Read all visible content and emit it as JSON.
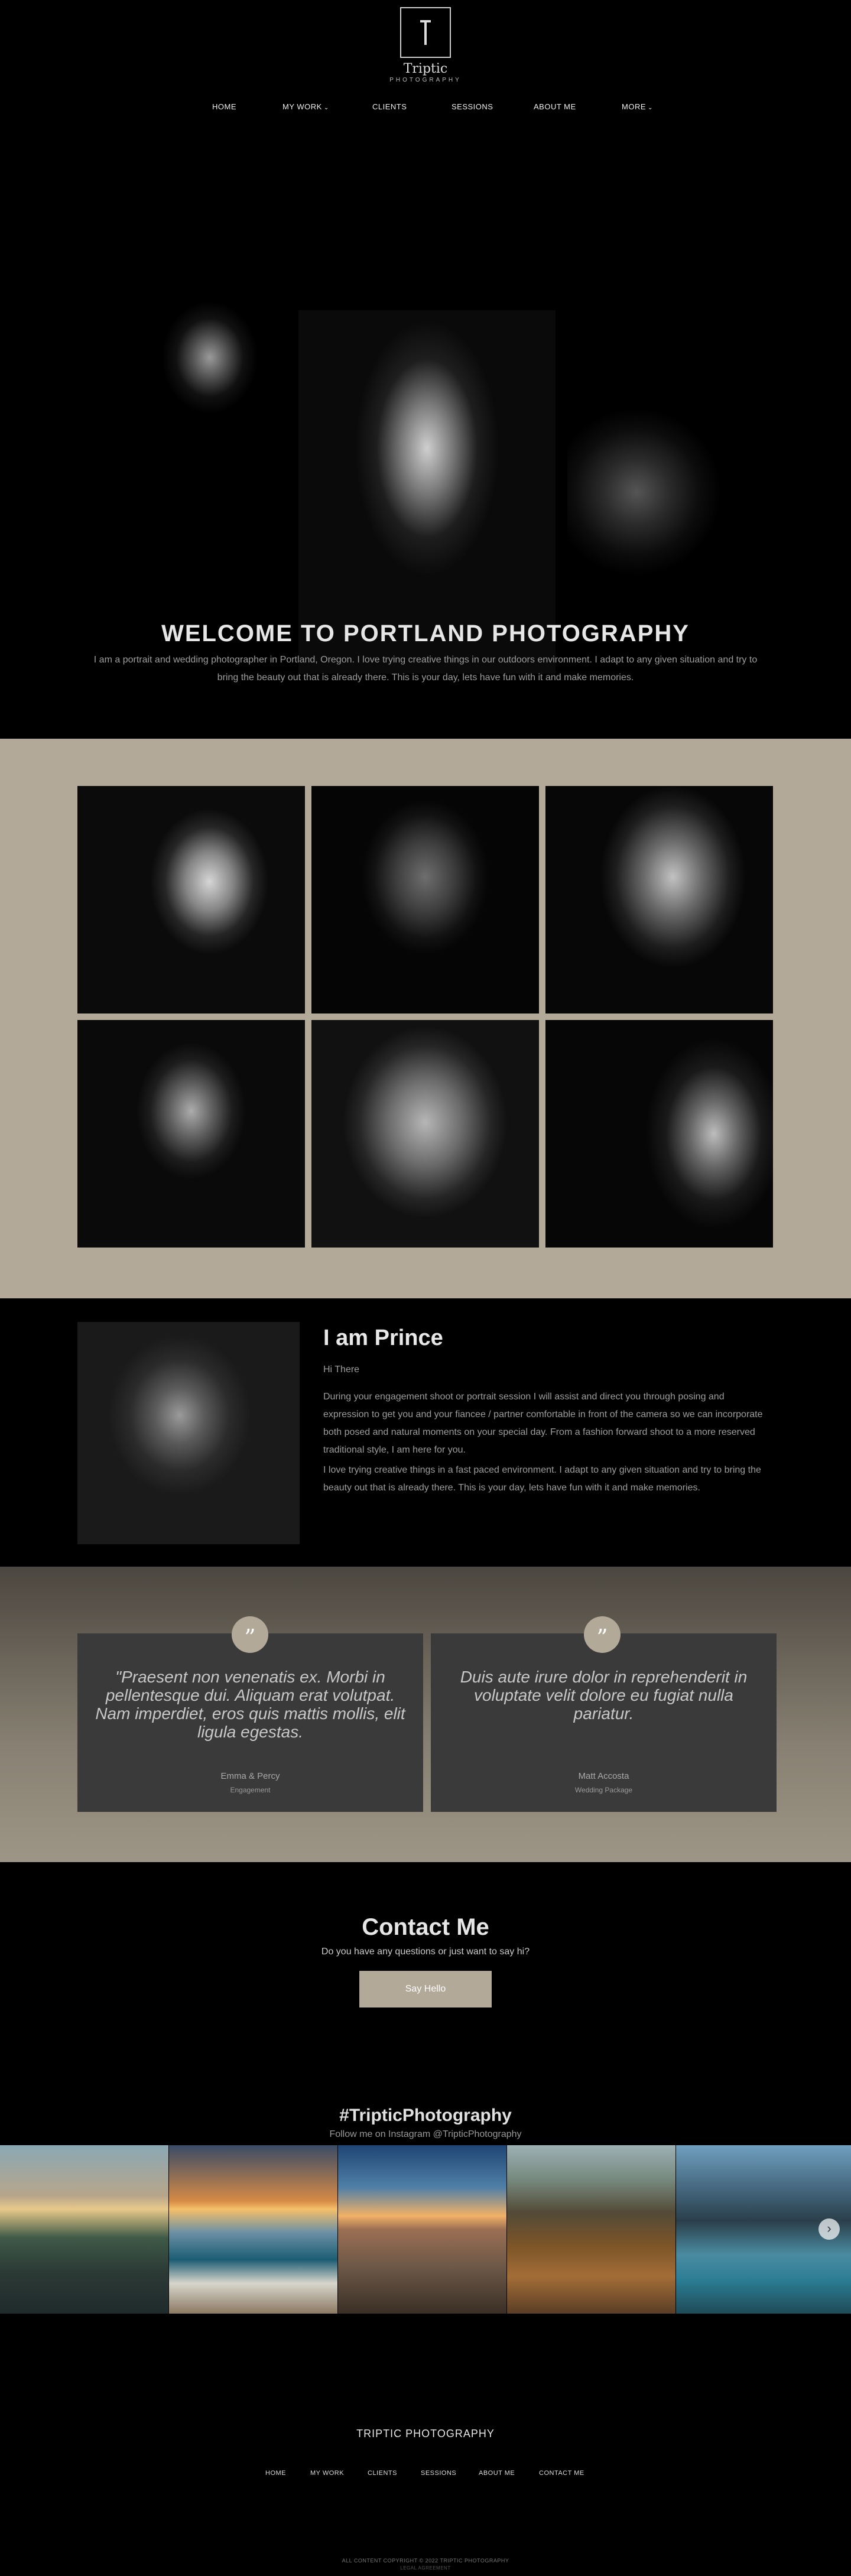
{
  "brand": {
    "name": "Triptic",
    "tagline": "PHOTOGRAPHY"
  },
  "nav": {
    "items": [
      {
        "label": "HOME",
        "dropdown": false
      },
      {
        "label": "MY WORK",
        "dropdown": true
      },
      {
        "label": "CLIENTS",
        "dropdown": false
      },
      {
        "label": "SESSIONS",
        "dropdown": false
      },
      {
        "label": "ABOUT ME",
        "dropdown": false
      },
      {
        "label": "MORE",
        "dropdown": true
      }
    ],
    "dropdown_icon": "chevron-down-icon"
  },
  "hero": {
    "title": "WELCOME TO PORTLAND PHOTOGRAPHY",
    "text": "I am a portrait and wedding photographer in Portland, Oregon. I love trying creative things in our outdoors environment. I adapt to any given situation and try to bring the beauty out that is already there. This is your day, lets have fun with it and make memories."
  },
  "gallery": {
    "background": "#b2a999",
    "tile_count": 6
  },
  "about": {
    "title": "I am Prince",
    "greeting": "Hi There",
    "paragraph1": "During your engagement shoot or portrait session I will assist and direct you through posing and expression to get you and your fiancee / partner comfortable in front of the camera so we can incorporate both posed and natural moments on your special day. From a fashion forward shoot to a more reserved traditional style, I am here for you.",
    "paragraph2": "I love trying creative things in a fast paced environment. I adapt to any given situation and try to bring the beauty out that is already there. This is your day, lets have fun with it and make memories."
  },
  "testimonials": [
    {
      "quote": "\"Praesent non venenatis ex. Morbi in pellentesque dui. Aliquam erat volutpat. Nam imperdiet, eros quis mattis mollis, elit ligula egestas.",
      "name": "Emma & Percy",
      "role": "Engagement",
      "icon": "quote-icon"
    },
    {
      "quote": "Duis aute irure dolor in reprehenderit in voluptate velit dolore eu fugiat nulla pariatur.",
      "name": "Matt Accosta",
      "role": "Wedding Package",
      "icon": "quote-icon"
    }
  ],
  "contact": {
    "title": "Contact Me",
    "subtitle": "Do you have any questions or just want to say hi?",
    "button": "Say Hello",
    "accent": "#b2a999"
  },
  "instagram": {
    "title": "#TripticPhotography",
    "subtitle": "Follow me on Instagram @TripticPhotography",
    "next_icon": "chevron-right-icon"
  },
  "footer": {
    "title": "TRIPTIC PHOTOGRAPHY",
    "nav": [
      "HOME",
      "MY WORK",
      "CLIENTS",
      "SESSIONS",
      "ABOUT ME",
      "CONTACT ME"
    ],
    "copyright": "ALL CONTENT COPYRIGHT © 2022 TRIPTIC PHOTOGRAPHY",
    "legal": "LEGAL AGREEMENT"
  }
}
